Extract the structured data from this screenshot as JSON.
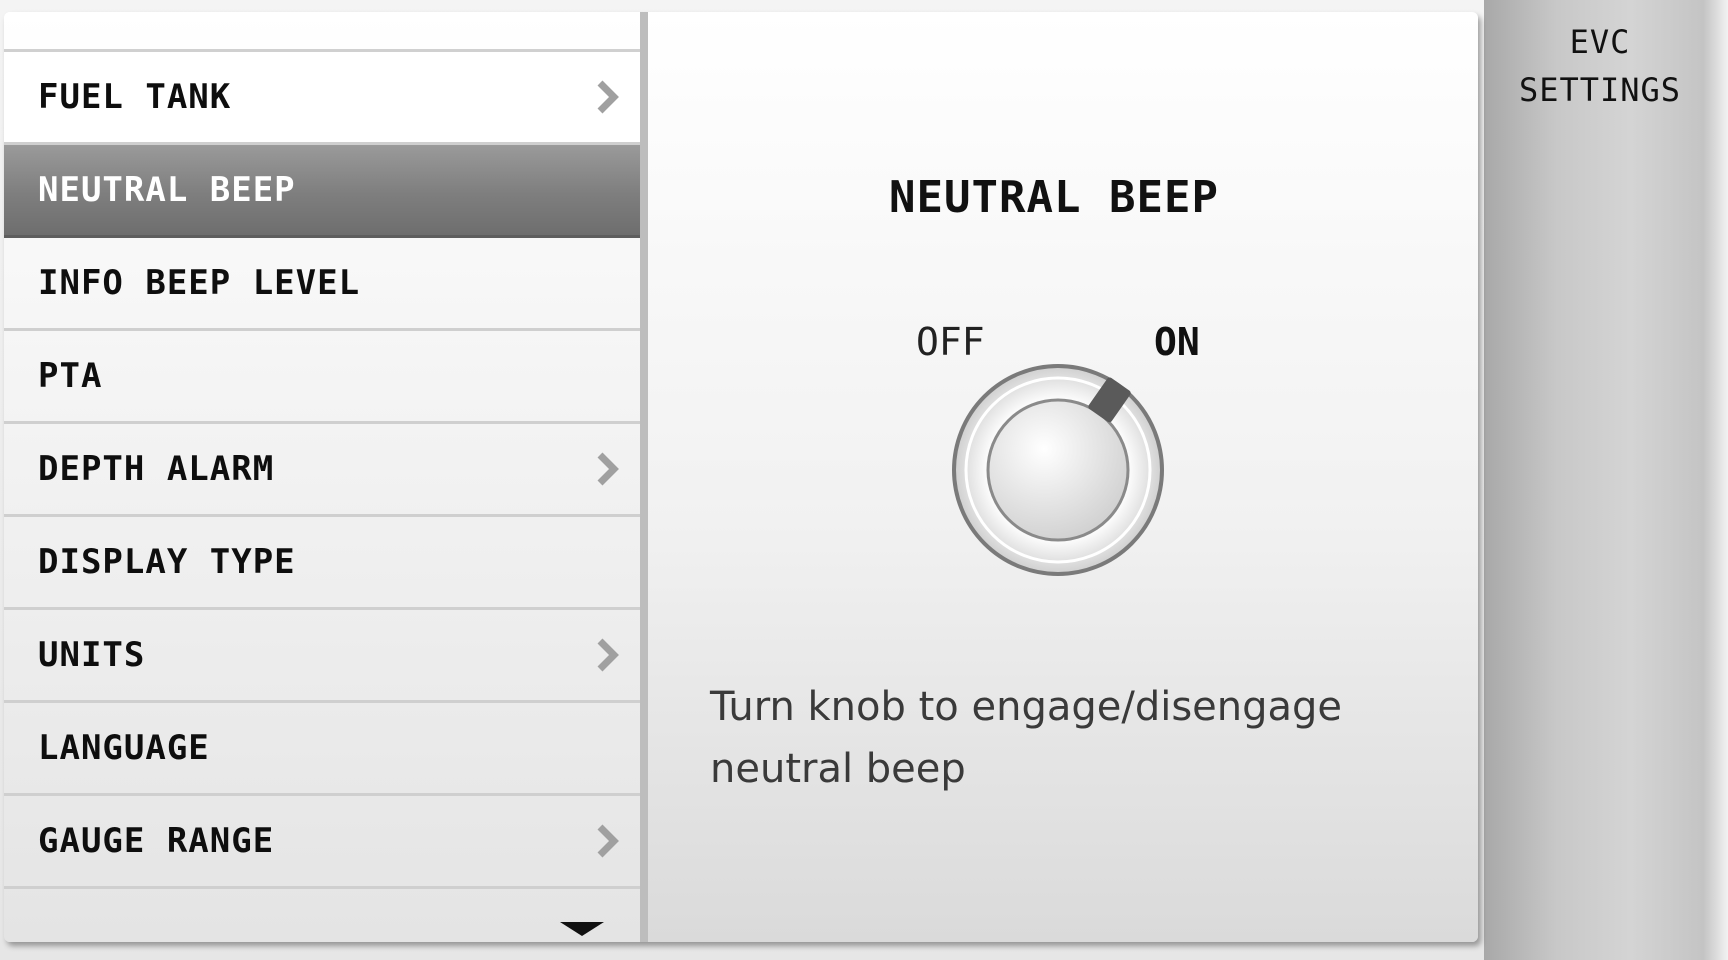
{
  "header": {
    "title": "EVC SETTINGS"
  },
  "menu": {
    "items": [
      {
        "label": "FUEL TANK",
        "has_submenu": true,
        "selected": false
      },
      {
        "label": "NEUTRAL BEEP",
        "has_submenu": false,
        "selected": true
      },
      {
        "label": "INFO BEEP LEVEL",
        "has_submenu": false,
        "selected": false
      },
      {
        "label": "PTA",
        "has_submenu": false,
        "selected": false
      },
      {
        "label": "DEPTH ALARM",
        "has_submenu": true,
        "selected": false
      },
      {
        "label": "DISPLAY TYPE",
        "has_submenu": false,
        "selected": false
      },
      {
        "label": "UNITS",
        "has_submenu": true,
        "selected": false
      },
      {
        "label": "LANGUAGE",
        "has_submenu": false,
        "selected": false
      },
      {
        "label": "GAUGE RANGE",
        "has_submenu": true,
        "selected": false
      }
    ],
    "scroll_icon": "chevron-down-icon"
  },
  "detail": {
    "title": "NEUTRAL BEEP",
    "knob": {
      "off_label": "OFF",
      "on_label": "ON",
      "state": "ON",
      "icon": "rotary-knob-icon"
    },
    "description": "Turn knob to engage/disengage neutral beep"
  },
  "colors": {
    "selected_row": "#7e7e7e",
    "text": "#111111",
    "indicator": "#5a5a5a"
  }
}
